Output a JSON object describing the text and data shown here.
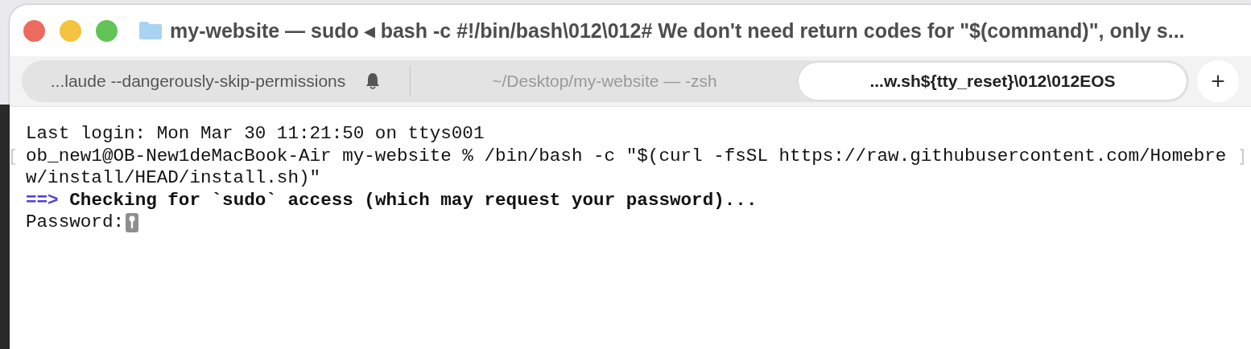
{
  "window": {
    "title": "my-website — sudo ◂ bash -c #!/bin/bash\\012\\012# We don't need return codes for \"$(command)\", only s..."
  },
  "tabs": [
    {
      "label": "...laude --dangerously-skip-permissions",
      "selected": false,
      "bell": true
    },
    {
      "label": "~/Desktop/my-website — -zsh",
      "selected": false,
      "bell": false
    },
    {
      "label": "...w.sh${tty_reset}\\012\\012EOS",
      "selected": true,
      "bell": false
    }
  ],
  "new_tab": {
    "label": "+"
  },
  "terminal": {
    "lines": [
      {
        "kind": "plain",
        "text": "Last login: Mon Mar 30 11:21:50 on ttys001"
      },
      {
        "kind": "prompt",
        "text": "ob_new1@OB-New1deMacBook-Air my-website % /bin/bash -c \"$(curl -fsSL https://raw.githubusercontent.com/Homebre"
      },
      {
        "kind": "plain",
        "text": "w/install/HEAD/install.sh)\""
      },
      {
        "kind": "info",
        "arrow": "==>",
        "text": "Checking for `sudo` access (which may request your password)..."
      },
      {
        "kind": "password",
        "text": "Password:"
      }
    ]
  }
}
